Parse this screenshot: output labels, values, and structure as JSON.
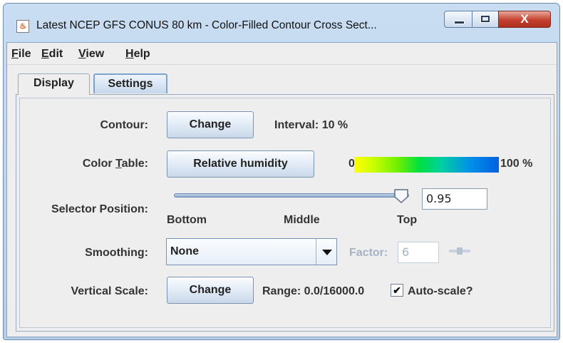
{
  "window": {
    "title": "Latest NCEP GFS CONUS 80 km - Color-Filled Contour Cross Sect...",
    "close_glyph": "X"
  },
  "menu": {
    "items": [
      {
        "label": "File",
        "mnemonic": "F",
        "rest": "ile"
      },
      {
        "label": "Edit",
        "mnemonic": "E",
        "rest": "dit"
      },
      {
        "label": "View",
        "mnemonic": "V",
        "rest": "iew"
      },
      {
        "label": "Help",
        "mnemonic": "H",
        "rest": "elp"
      }
    ]
  },
  "tabs": [
    {
      "label": "Display",
      "active": true
    },
    {
      "label": "Settings",
      "active": false
    }
  ],
  "contour": {
    "label": "Contour:",
    "button_label": "Change",
    "interval_text": "Interval: 10 %"
  },
  "color_table": {
    "label_before": "Color ",
    "label_mnemonic": "T",
    "label_after": "able:",
    "button_label": "Relative humidity",
    "min_label": "0",
    "max_label": "100 %"
  },
  "selector": {
    "label": "Selector Position:",
    "value": "0.95",
    "position_fraction": 0.95,
    "ticks": [
      "Bottom",
      "Middle",
      "Top"
    ]
  },
  "smoothing": {
    "label": "Smoothing:",
    "selected": "None",
    "factor_label": "Factor:",
    "factor_value": "6"
  },
  "vertical_scale": {
    "label": "Vertical Scale:",
    "button_label": "Change",
    "range_text": "Range: 0.0/16000.0",
    "autoscale_label": "Auto-scale?",
    "autoscale_checked": true
  },
  "colors": {
    "titlebar": "#c9ddf2",
    "close_button": "#c4402f",
    "panel_bg": "#eeeeee",
    "accent_border": "#7fa3cf"
  },
  "icons": [
    "java-app-icon",
    "minimize-icon",
    "maximize-icon",
    "close-icon",
    "slider-thumb-icon",
    "dropdown-arrow-icon",
    "checkmark-icon",
    "mini-slider-icon"
  ]
}
